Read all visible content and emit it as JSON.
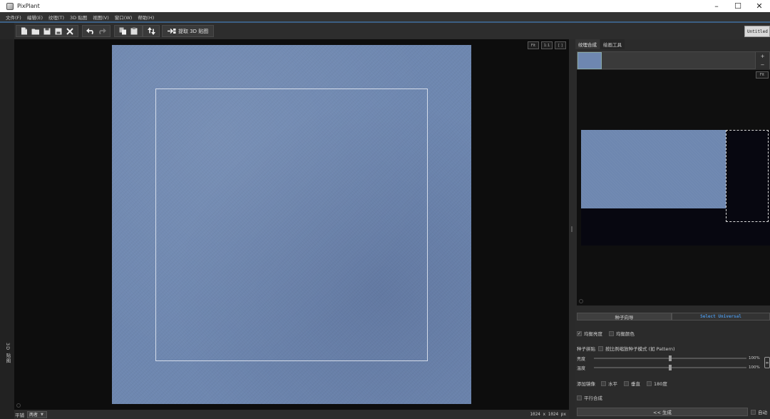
{
  "window": {
    "title": "PixPlant",
    "controls": {
      "minimize": "–",
      "maximize": "☐",
      "close": "✕"
    }
  },
  "menu": [
    "文件(F)",
    "编辑(E)",
    "纹理(T)",
    "3D 贴图",
    "视图(V)",
    "窗口(W)",
    "帮助(H)"
  ],
  "toolbar": {
    "extract_3d_label": "提取 3D 贴图",
    "doc_tab_label": "Untitled"
  },
  "canvas": {
    "view_buttons": [
      "Fit",
      "1:1",
      "[ ]"
    ]
  },
  "left_strip": {
    "vertical_label": "3D 贴图"
  },
  "statusbar": {
    "tile_label": "平铺",
    "tile_mode": "两者",
    "caret": "▼",
    "image_size": "1024 x 1024 px"
  },
  "panel": {
    "tabs": [
      "纹理合成",
      "绘画工具"
    ],
    "thumb_side": [
      "+",
      "−"
    ],
    "fit_label": "Fit",
    "buttons": {
      "seed_guide": "种子向导",
      "select_universal": "Select Universal"
    },
    "options": {
      "balance_brightness": "均衡亮度",
      "balance_color": "均衡颜色",
      "seed_tile": "种子拼贴",
      "pattern_mode": "按比例缩放种子模式 (如 Pattern)",
      "add_mirror": "添加镜像",
      "horizontal": "水平",
      "vertical": "垂直",
      "rotate_180": "180度",
      "parallel_synthesis": "平行合成",
      "auto": "自动"
    },
    "sliders": [
      {
        "label": "亮度",
        "value": 0.5,
        "display": "100%"
      },
      {
        "label": "温度",
        "value": 0.5,
        "display": "100%"
      }
    ],
    "generate_label": "<< 生成"
  },
  "colors": {
    "texture_blue": "#6e87b0",
    "accent_blue": "#4a8fd6",
    "menubar": "#323232"
  }
}
